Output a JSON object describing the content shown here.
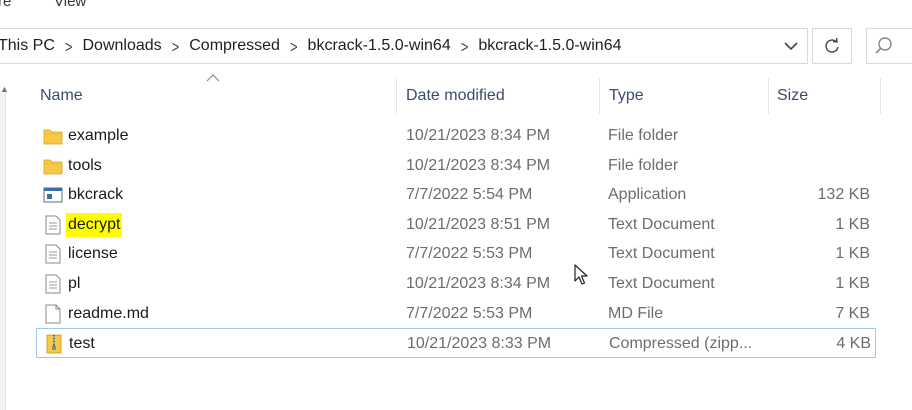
{
  "ribbon": {
    "tab1": "re",
    "tab2": "View"
  },
  "address": {
    "crumbs": [
      "This PC",
      "Downloads",
      "Compressed",
      "bkcrack-1.5.0-win64",
      "bkcrack-1.5.0-win64"
    ],
    "separator": ">"
  },
  "columns": {
    "name": "Name",
    "date": "Date modified",
    "type": "Type",
    "size": "Size"
  },
  "files": [
    {
      "name": "example",
      "date": "10/21/2023 8:34 PM",
      "type": "File folder",
      "size": "",
      "icon": "folder-icon"
    },
    {
      "name": "tools",
      "date": "10/21/2023 8:34 PM",
      "type": "File folder",
      "size": "",
      "icon": "folder-icon"
    },
    {
      "name": "bkcrack",
      "date": "7/7/2022 5:54 PM",
      "type": "Application",
      "size": "132 KB",
      "icon": "application-icon"
    },
    {
      "name": "decrypt",
      "date": "10/21/2023 8:51 PM",
      "type": "Text Document",
      "size": "1 KB",
      "icon": "text-document-icon",
      "highlight": "#ffff00"
    },
    {
      "name": "license",
      "date": "7/7/2022 5:53 PM",
      "type": "Text Document",
      "size": "1 KB",
      "icon": "text-document-icon"
    },
    {
      "name": "pl",
      "date": "10/21/2023 8:34 PM",
      "type": "Text Document",
      "size": "1 KB",
      "icon": "text-document-icon"
    },
    {
      "name": "readme.md",
      "date": "7/7/2022 5:53 PM",
      "type": "MD File",
      "size": "7 KB",
      "icon": "file-icon"
    },
    {
      "name": "test",
      "date": "10/21/2023 8:33 PM",
      "type": "Compressed (zipp...",
      "size": "4 KB",
      "icon": "zip-folder-icon",
      "selected": true
    }
  ],
  "colors": {
    "folder": "#f7c948",
    "highlight": "#ffff00",
    "selection_border": "#99c9ef",
    "header_text": "#3c4c6c"
  }
}
